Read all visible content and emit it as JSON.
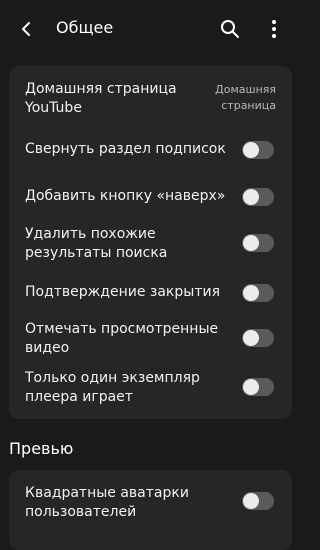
{
  "header": {
    "title": "Общее",
    "back_icon": "back-arrow-icon",
    "search_icon": "search-icon",
    "more_icon": "more-vert-icon"
  },
  "general": {
    "homepage": {
      "label": "Домашняя страница YouTube",
      "value": "Домашняя страница"
    },
    "toggles": [
      {
        "label": "Свернуть раздел подписок",
        "on": false
      },
      {
        "label": "Добавить кнопку «наверх»",
        "on": false
      },
      {
        "label": "Удалить похожие результаты поиска",
        "on": false
      },
      {
        "label": "Подтверждение закрытия",
        "on": false
      },
      {
        "label": "Отмечать просмотренные видео",
        "on": false
      },
      {
        "label": "Только один экземпляр плеера играет",
        "on": false
      }
    ]
  },
  "preview": {
    "section_title": "Превью",
    "toggles": [
      {
        "label": "Квадратные аватарки пользователей",
        "on": false
      }
    ]
  },
  "colors": {
    "background": "#1a1a1a",
    "card": "#262626",
    "toggle_off_track": "#5a5a5a",
    "toggle_knob": "#ececec"
  }
}
